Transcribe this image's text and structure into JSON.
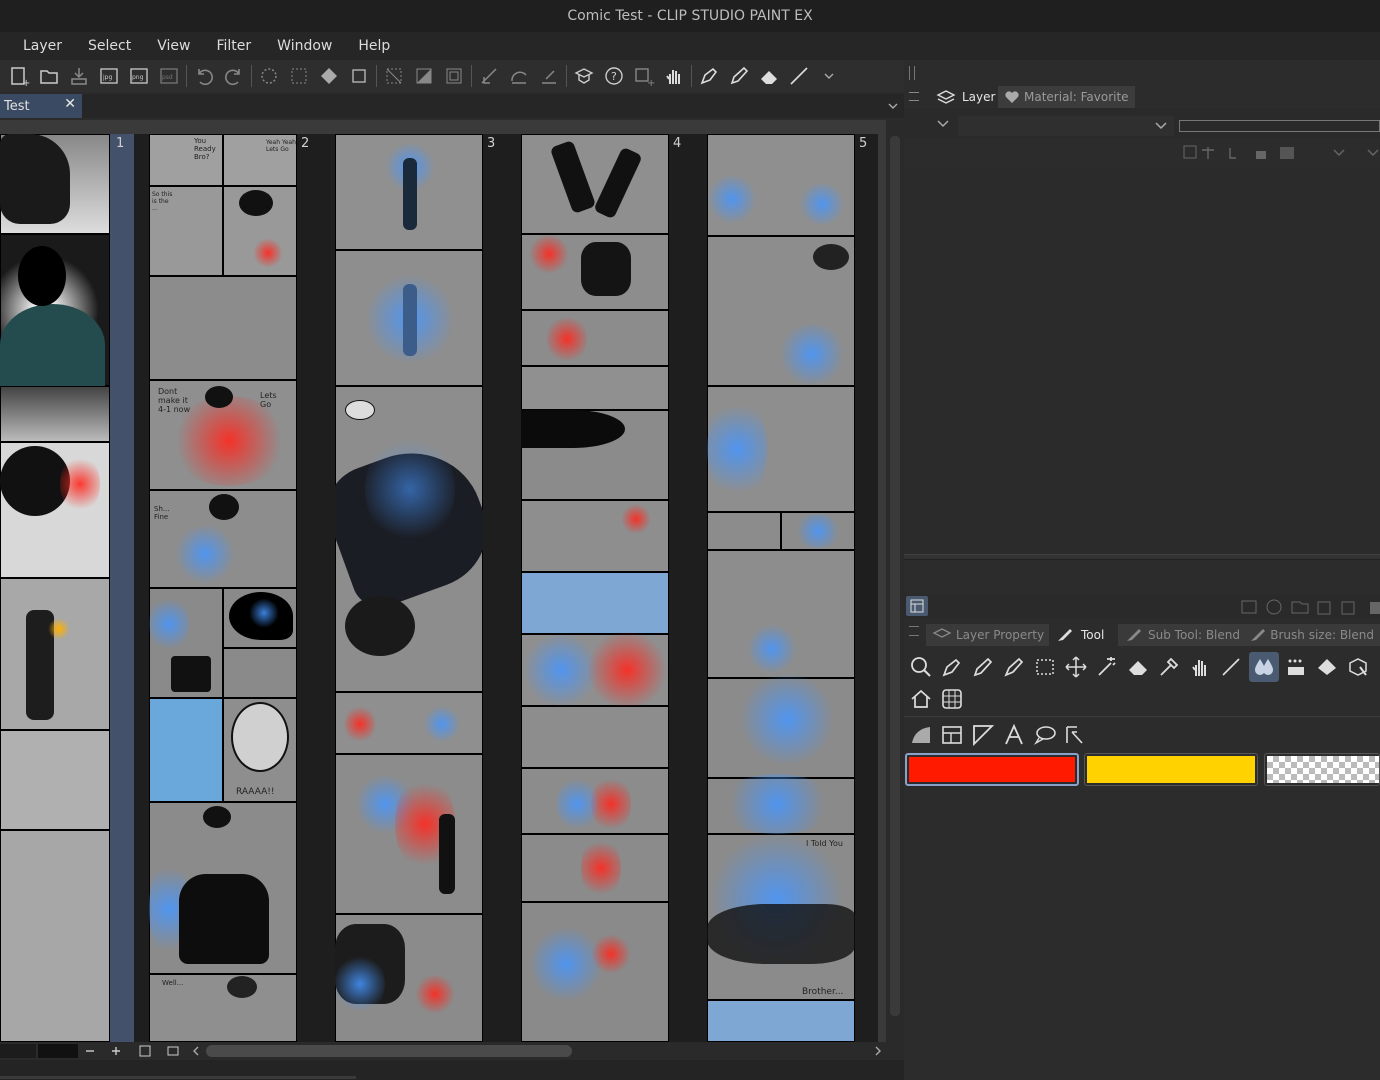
{
  "window": {
    "title": "Comic Test - CLIP STUDIO PAINT EX"
  },
  "menu": [
    "Layer",
    "Select",
    "View",
    "Filter",
    "Window",
    "Help"
  ],
  "document_tab": {
    "label": "Test",
    "close": "✕"
  },
  "pages": [
    {
      "number": "1"
    },
    {
      "number": "2"
    },
    {
      "number": "3"
    },
    {
      "number": "4"
    },
    {
      "number": "5"
    }
  ],
  "comic_text": {
    "p2_a": "You Ready Bro?",
    "p2_b": "Yeah Yeah Lets Go",
    "p2_c": "So this is the ...",
    "p2_d": "Dont make it 4-1 now",
    "p2_e": "Lets Go",
    "p2_f": "Sh... Fine",
    "p2_g": "RAAAA!!",
    "p2_h": "Well...",
    "p5_a": "I Told You",
    "p5_b": "Brother..."
  },
  "layer_panel": {
    "tabs": [
      "Layer",
      "Material: Favorite"
    ]
  },
  "tool_panel": {
    "tabs": [
      "Layer Property",
      "Tool",
      "Sub Tool: Blend",
      "Brush size: Blend"
    ],
    "swatches": [
      {
        "name": "red",
        "color": "#ff1a00"
      },
      {
        "name": "yellow",
        "color": "#ffd200"
      },
      {
        "name": "transparent",
        "color": "checker"
      }
    ]
  },
  "colors": {
    "accent": "#3b4a63",
    "selected_tool": "#4a5a70"
  }
}
